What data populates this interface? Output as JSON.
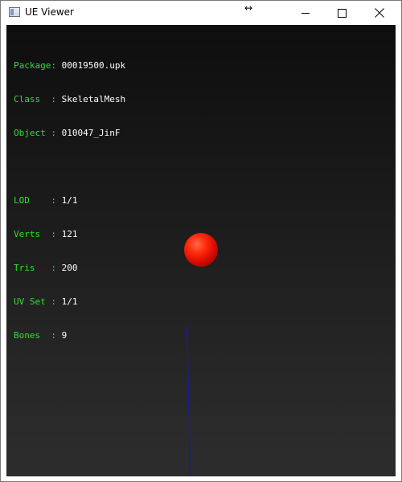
{
  "window": {
    "title": "UE Viewer",
    "cursor_glyph": "↔"
  },
  "icons": {
    "app": "app-window-icon",
    "minimize": "minimize-icon",
    "maximize": "maximize-icon",
    "close": "close-icon"
  },
  "info": {
    "package": {
      "label": "Package",
      "value": "00019500.upk"
    },
    "class": {
      "label": "Class  ",
      "value": "SkeletalMesh"
    },
    "object": {
      "label": "Object ",
      "value": "010047_JinF"
    },
    "lod": {
      "label": "LOD    ",
      "value": "1/1"
    },
    "verts": {
      "label": "Verts  ",
      "value": "121"
    },
    "tris": {
      "label": "Tris   ",
      "value": "200"
    },
    "uvset": {
      "label": "UV Set ",
      "value": "1/1"
    },
    "bones": {
      "label": "Bones  ",
      "value": "9"
    }
  },
  "colors": {
    "label_green": "#33dd33",
    "value_white": "#ffffff",
    "viewport_dark": "#111111",
    "sphere_red": "#ff2a0a",
    "bone_blue": "#1a1aa0"
  }
}
